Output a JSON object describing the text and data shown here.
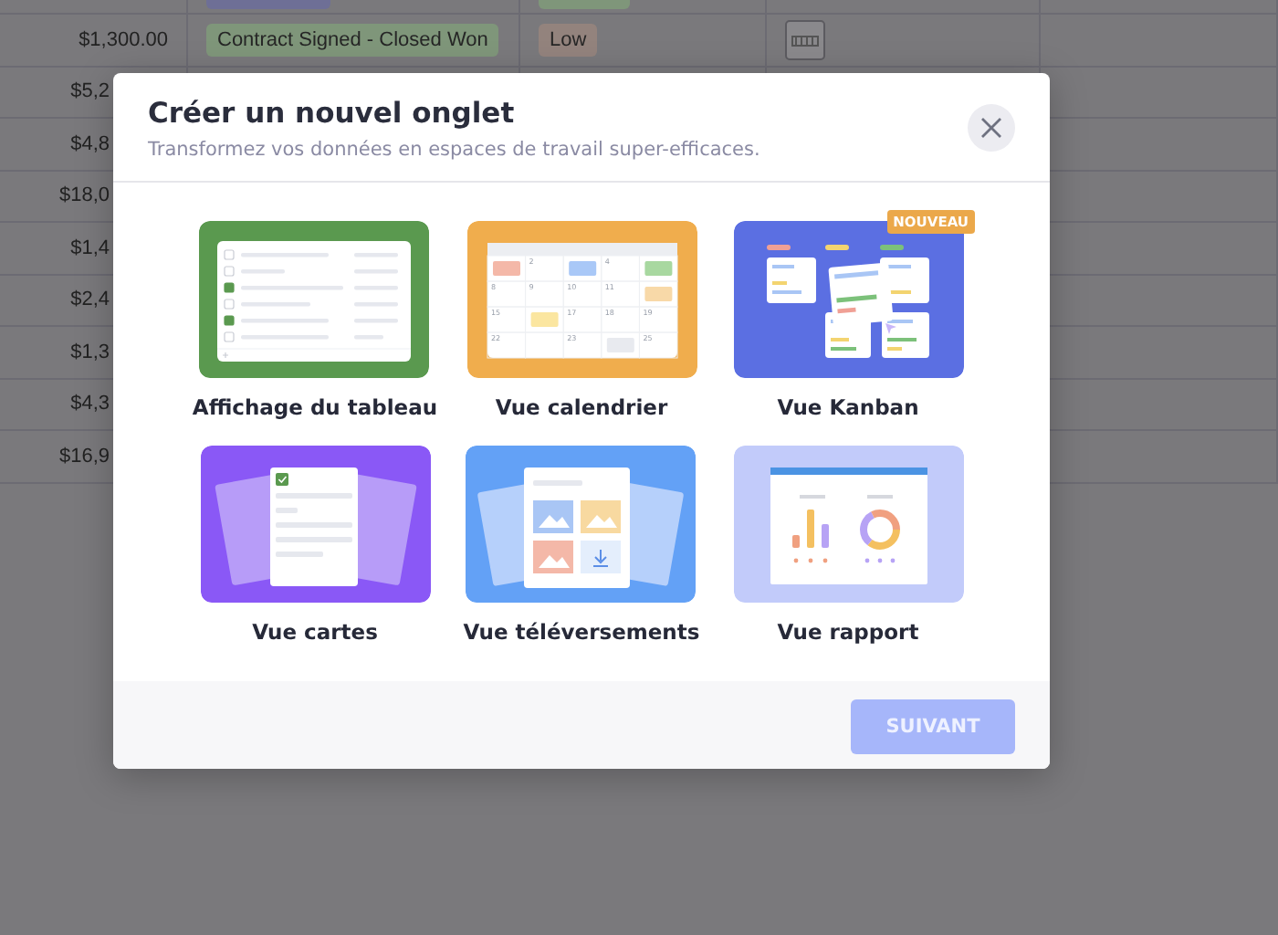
{
  "sheet": {
    "rows": [
      {
        "amount": "$1,300.00",
        "stage": {
          "label": "Contract Signed - Closed Won",
          "color": "#7f967a"
        },
        "priority": {
          "label": "Low",
          "color": "#93837d"
        }
      },
      {
        "amount": "$5,2"
      },
      {
        "amount": "$4,8"
      },
      {
        "amount": "$18,0"
      },
      {
        "amount": "$1,4"
      },
      {
        "amount": "$2,4"
      },
      {
        "amount": "$1,3"
      },
      {
        "amount": "$4,3"
      },
      {
        "amount": "$16,9"
      }
    ]
  },
  "dialog": {
    "title": "Créer un nouvel onglet",
    "subtitle": "Transformez vos données en espaces de travail super-efficaces.",
    "tiles": [
      {
        "kind": "table",
        "label": "Affichage du tableau",
        "selected": false,
        "checks": [
          false,
          false,
          true,
          false,
          true,
          false
        ]
      },
      {
        "kind": "calendar",
        "label": "Vue calendrier",
        "selected": false,
        "cells": [
          {
            "color": "#f4b8a8"
          },
          {
            "day": "2"
          },
          {
            "color": "#a9c8f7"
          },
          {
            "day": "4"
          },
          {
            "color": "#a8d8a0"
          },
          {
            "day": "8"
          },
          {
            "day": "9"
          },
          {
            "day": "10"
          },
          {
            "day": "11"
          },
          {
            "color": "#f8d9a8"
          },
          {
            "day": "15"
          },
          {
            "color": "#fbe6a0"
          },
          {
            "day": "17"
          },
          {
            "day": "18"
          },
          {
            "day": "19"
          },
          {
            "day": "22"
          },
          {},
          {
            "day": "23"
          },
          {
            "color": "#e8eaef"
          },
          {
            "day": "25"
          }
        ]
      },
      {
        "kind": "kanban",
        "label": "Vue Kanban",
        "selected": false,
        "badge": "NOUVEAU"
      },
      {
        "kind": "cards",
        "label": "Vue cartes",
        "selected": false
      },
      {
        "kind": "uploads",
        "label": "Vue téléversements",
        "selected": false
      },
      {
        "kind": "report",
        "label": "Vue rapport",
        "selected": false
      }
    ],
    "next_button": {
      "label": "SUIVANT",
      "disabled": true
    }
  }
}
